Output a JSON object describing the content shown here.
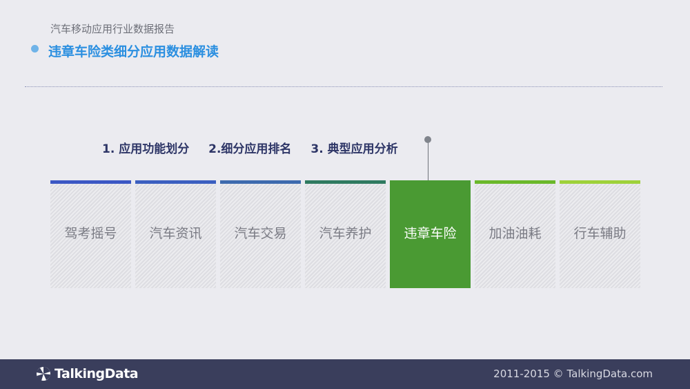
{
  "header": {
    "report_title": "汽车移动应用行业数据报告",
    "section_title": "违章车险类细分应用数据解读"
  },
  "steps": [
    "1. 应用功能划分",
    "2.细分应用排名",
    "3. 典型应用分析"
  ],
  "categories": [
    {
      "label": "驾考摇号",
      "bar_color": "#3b57c4",
      "active": false
    },
    {
      "label": "汽车资讯",
      "bar_color": "#3b5fc0",
      "active": false
    },
    {
      "label": "汽车交易",
      "bar_color": "#3d6aae",
      "active": false
    },
    {
      "label": "汽车养护",
      "bar_color": "#2f7a60",
      "active": false
    },
    {
      "label": "违章车险",
      "bar_color": "#4a9a33",
      "active": true
    },
    {
      "label": "加油油耗",
      "bar_color": "#6ab82a",
      "active": false
    },
    {
      "label": "行车辅助",
      "bar_color": "#9ed13a",
      "active": false
    }
  ],
  "footer": {
    "logo_text": "TalkingData",
    "logo_icon": "talkingdata-logo-icon",
    "copyright": "2011-2015 © TalkingData.com"
  },
  "colors": {
    "accent": "#2b8fe0",
    "active_green": "#4a9a33",
    "footer_bg": "#3a3e5c"
  }
}
